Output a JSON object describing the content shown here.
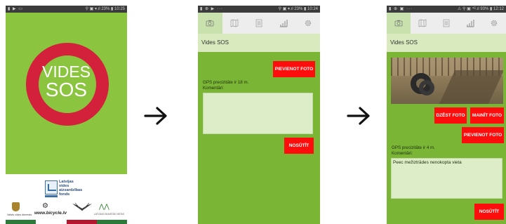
{
  "screen1": {
    "status_left": "▮ ▶ ▭",
    "status_right": "⚲ ▣ ▾.ıl 23% ▮ 10:25",
    "logo_line1": "VIDES",
    "logo_line2": "SOS",
    "ring_color": "#d3213c",
    "bg_color": "#8bc53f",
    "sponsor_lines": [
      "Latvijas",
      "vides",
      "aizsardzības",
      "fonds"
    ],
    "crest_caption": "Valsts vides dienests",
    "bicycle_text": "www.bicycle.lv",
    "sw_caption": "LATVIJAS SKAISTĀS VIETAS"
  },
  "screen2": {
    "status_left": "▮ ⊕ ▶ ···",
    "status_right": "⚲ ▣ ▾.ıl 23% ▮ 10:24",
    "title": "Vides SOS",
    "add_photo_label": "PIEVIENOT FOTO",
    "gps_text": "GPS precizitāte ir 18 m.",
    "comment_label": "Komentāri:",
    "comment_value": "",
    "send_label": "NOSŪTĪT"
  },
  "screen3": {
    "status_left": "▮ ⊕ ▣ ···",
    "status_right": "⚠ ⚲ ▣ ⁴ᴳ.ıl 93% ▮ 12:12",
    "title": "Vides SOS",
    "delete_photo_label": "DZĒST FOTO",
    "change_photo_label": "MAINĪT FOTO",
    "add_photo_label": "PIEVIENOT FOTO",
    "gps_text": "GPS precizitāte ir 4 m.",
    "comment_label": "Komentāri:",
    "comment_value": "Peec mežiztrādes nenokopta vieta",
    "send_label": "NOSŪTĪT"
  },
  "tabs": [
    "camera-icon",
    "map-icon",
    "list-icon",
    "chart-icon",
    "gear-icon"
  ],
  "colors": {
    "accent_red": "#ff0d0d",
    "content_green": "#7ab536",
    "title_bg": "#d9eabf",
    "active_tab": "#c9e2ad"
  }
}
